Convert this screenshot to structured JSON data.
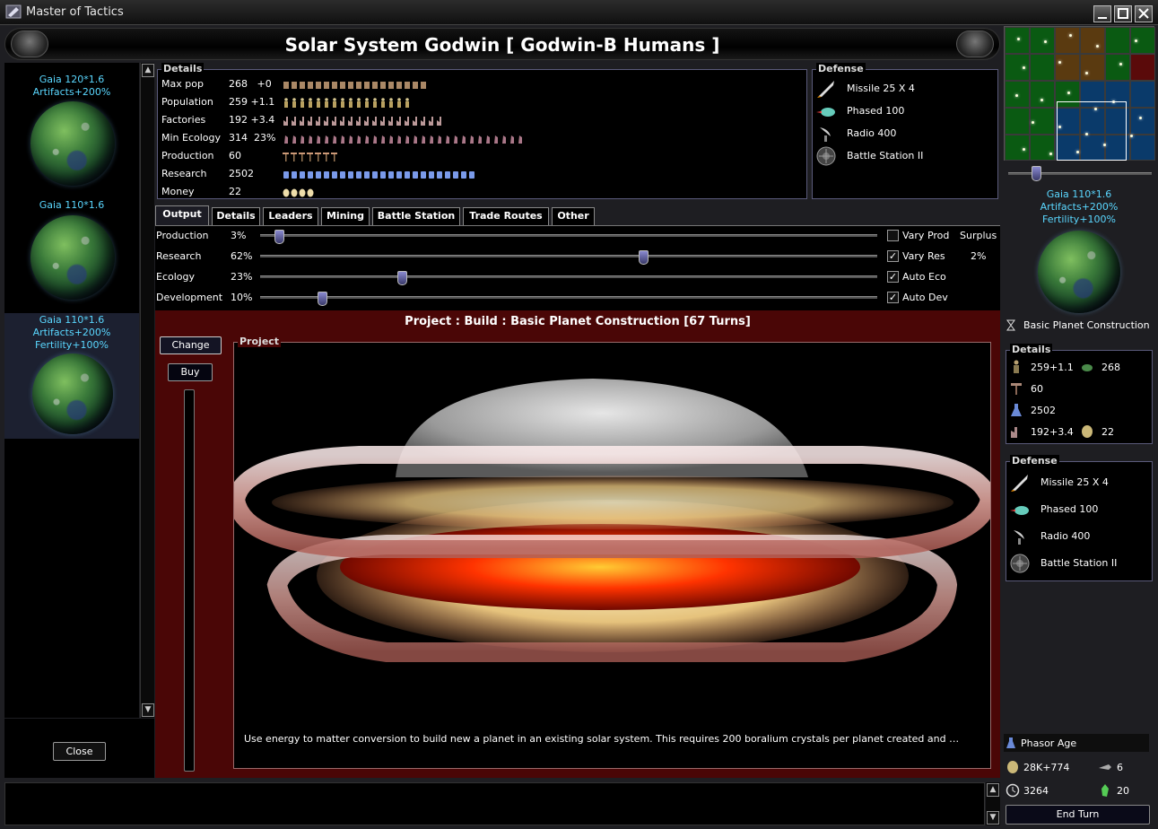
{
  "window": {
    "title": "Master of Tactics"
  },
  "header": {
    "title": "Solar System Godwin [ Godwin-B Humans ]"
  },
  "planet_list": [
    {
      "line1": "Gaia 120*1.6",
      "line2": "Artifacts+200%",
      "line3": ""
    },
    {
      "line1": "Gaia 110*1.6",
      "line2": "",
      "line3": ""
    },
    {
      "line1": "Gaia 110*1.6",
      "line2": "Artifacts+200%",
      "line3": "Fertility+100%",
      "selected": true
    }
  ],
  "left": {
    "close_label": "Close"
  },
  "details": {
    "label": "Details",
    "rows": [
      {
        "label": "Max pop",
        "value": "268   +0",
        "icon": "pop-icon",
        "count": 18
      },
      {
        "label": "Population",
        "value": "259 +1.1",
        "icon": "colonist-icon",
        "count": 16
      },
      {
        "label": "Factories",
        "value": "192 +3.4",
        "icon": "factory-icon",
        "count": 20
      },
      {
        "label": "Min Ecology",
        "value": "314  23%",
        "icon": "ecology-icon",
        "count": 30
      },
      {
        "label": "Production",
        "value": "60",
        "icon": "hammer-icon",
        "count": 7
      },
      {
        "label": "Research",
        "value": "2502",
        "icon": "flask-icon",
        "count": 24
      },
      {
        "label": "Money",
        "value": "22",
        "icon": "coin-icon",
        "count": 4
      }
    ]
  },
  "defense": {
    "label": "Defense",
    "items": [
      {
        "label": "Missile 25 X 4",
        "icon": "missile-icon"
      },
      {
        "label": "Phased 100",
        "icon": "shield-icon"
      },
      {
        "label": "Radio 400",
        "icon": "radar-dish-icon"
      },
      {
        "label": "Battle Station II",
        "icon": "battle-station-icon"
      }
    ]
  },
  "tabs": [
    {
      "label": "Output",
      "active": true
    },
    {
      "label": "Details"
    },
    {
      "label": "Leaders"
    },
    {
      "label": "Mining"
    },
    {
      "label": "Battle Station"
    },
    {
      "label": "Trade Routes"
    },
    {
      "label": "Other"
    }
  ],
  "output": {
    "sliders": [
      {
        "label": "Production",
        "percent": "3%",
        "value": 3,
        "check_label": "Vary Prod",
        "checked": false,
        "extra": "Surplus"
      },
      {
        "label": "Research",
        "percent": "62%",
        "value": 62,
        "check_label": "Vary Res",
        "checked": true,
        "extra": "2%"
      },
      {
        "label": "Ecology",
        "percent": "23%",
        "value": 23,
        "check_label": "Auto Eco",
        "checked": true,
        "extra": ""
      },
      {
        "label": "Development",
        "percent": "10%",
        "value": 10,
        "check_label": "Auto Dev",
        "checked": true,
        "extra": ""
      }
    ]
  },
  "project": {
    "title": "Project :  Build : Basic Planet Construction [67 Turns]",
    "change_label": "Change",
    "buy_label": "Buy",
    "box_label": "Project",
    "description": "Use energy to matter conversion to build new a planet in an existing solar system. This requires 200 boralium crystals per planet created and …"
  },
  "right": {
    "planet": {
      "line1": "Gaia 110*1.6",
      "line2": "Artifacts+200%",
      "line3": "Fertility+100%"
    },
    "project_name": "Basic Planet Construction",
    "details_label": "Details",
    "stats": {
      "population": "259+1.1",
      "max_pop": "268",
      "production": "60",
      "research": "2502",
      "factories": "192+3.4",
      "money": "22"
    },
    "defense_label": "Defense",
    "defense": [
      {
        "label": "Missile 25 X 4",
        "icon": "missile-icon"
      },
      {
        "label": "Phased 100",
        "icon": "shield-icon"
      },
      {
        "label": "Radio 400",
        "icon": "radar-dish-icon"
      },
      {
        "label": "Battle Station II",
        "icon": "battle-station-icon"
      }
    ],
    "empire": {
      "age": "Phasor Age",
      "treasury": "28K+774",
      "ships": "6",
      "turn": "3264",
      "resources": "20"
    },
    "end_turn_label": "End Turn"
  },
  "colors": {
    "accent_cyan": "#5ad7ff",
    "project_bg": "#4a0606",
    "panel_border": "#5a5a7a"
  }
}
